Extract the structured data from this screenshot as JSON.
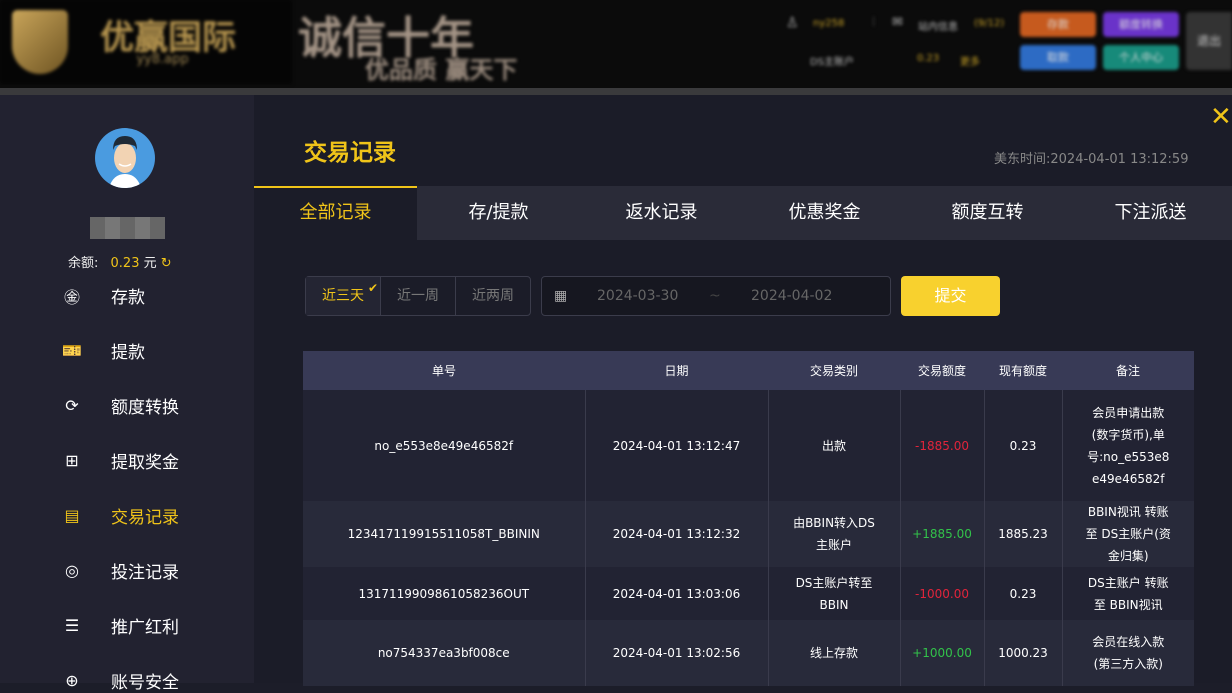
{
  "header": {
    "logo_name": "优赢国际",
    "logo_url": "yy8.app",
    "slogan_main": "诚信十年",
    "slogan_sub": "优品质  赢天下",
    "username": "ny258",
    "messages_label": "站内信息",
    "messages_count": "(9/12)",
    "account_label": "DS主账户",
    "account_balance": "0.23",
    "more_label": "更多",
    "buttons": {
      "deposit": "存款",
      "transfer": "额度转换",
      "withdraw": "取款",
      "profile": "个人中心",
      "logout": "退出"
    },
    "colors": {
      "deposit": "#c65a1e",
      "transfer": "#6a33c9",
      "withdraw": "#2d6bc4",
      "profile": "#178a7a"
    }
  },
  "sidebar": {
    "balance_label": "余额:",
    "balance_value": "0.23",
    "balance_unit": "元",
    "items": [
      {
        "label": "存款",
        "icon": "yen-circle-icon"
      },
      {
        "label": "提款",
        "icon": "ticket-icon"
      },
      {
        "label": "额度转换",
        "icon": "exchange-icon"
      },
      {
        "label": "提取奖金",
        "icon": "gift-icon"
      },
      {
        "label": "交易记录",
        "icon": "clipboard-icon",
        "active": true
      },
      {
        "label": "投注记录",
        "icon": "bet-icon"
      },
      {
        "label": "推广红利",
        "icon": "coins-icon"
      },
      {
        "label": "账号安全",
        "icon": "shield-icon"
      }
    ]
  },
  "main": {
    "title": "交易记录",
    "time_label": "美东时间:",
    "time_value": "2024-04-01 13:12:59",
    "tabs": [
      "全部记录",
      "存/提款",
      "返水记录",
      "优惠奖金",
      "额度互转",
      "下注派送"
    ],
    "filters": {
      "ranges": [
        "近三天",
        "近一周",
        "近两周"
      ],
      "start_date": "2024-03-30",
      "separator": "~",
      "end_date": "2024-04-02",
      "submit": "提交"
    },
    "table": {
      "columns": [
        "单号",
        "日期",
        "交易类别",
        "交易额度",
        "现有额度",
        "备注"
      ],
      "rows": [
        {
          "id": "no_e553e8e49e46582f",
          "date": "2024-04-01 13:12:47",
          "type": "出款",
          "amount": "-1885.00",
          "balance": "0.23",
          "note": "会员申请出款(数字货币),单号:no_e553e8e49e46582f"
        },
        {
          "id": "12341711991551105 8T_BBININ",
          "date": "2024-04-01 13:12:32",
          "type": "由BBIN转入DS主账户",
          "amount": "+1885.00",
          "balance": "1885.23",
          "note": "BBIN视讯 转账至 DS主账户(资金归集)"
        },
        {
          "id": "1317119909861058236OUT",
          "date": "2024-04-01 13:03:06",
          "type": "DS主账户转至BBIN",
          "amount": "-1000.00",
          "balance": "0.23",
          "note": "DS主账户 转账至 BBIN视讯"
        },
        {
          "id": "no754337ea3bf008ce",
          "date": "2024-04-01 13:02:56",
          "type": "线上存款",
          "amount": "+1000.00",
          "balance": "1000.23",
          "note": "会员在线入款(第三方入款)"
        }
      ]
    }
  }
}
